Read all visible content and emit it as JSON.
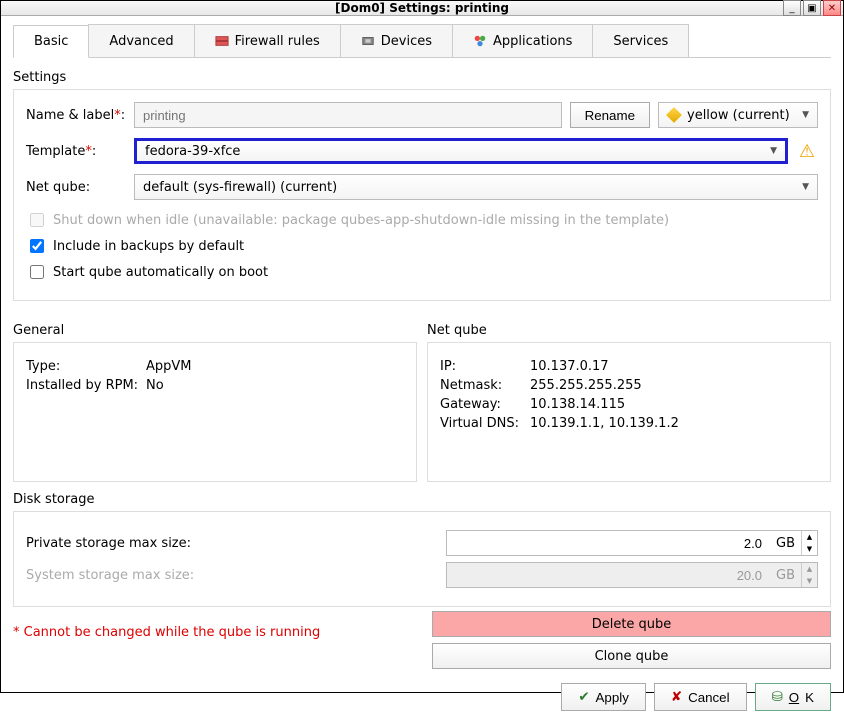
{
  "window": {
    "title": "[Dom0] Settings: printing"
  },
  "tabs": {
    "basic": "Basic",
    "advanced": "Advanced",
    "firewall": "Firewall rules",
    "devices": "Devices",
    "applications": "Applications",
    "services": "Services"
  },
  "settings": {
    "heading": "Settings",
    "name_label": "Name & label",
    "name_value": "printing",
    "rename_btn": "Rename",
    "color_label": "yellow (current)",
    "template_label": "Template",
    "template_value": "fedora-39-xfce",
    "netqube_label": "Net qube:",
    "netqube_value": "default (sys-firewall) (current)",
    "shutdown_idle": "Shut down when idle (unavailable: package qubes-app-shutdown-idle missing in the template)",
    "include_backups": "Include in backups by default",
    "autostart": "Start qube automatically on boot"
  },
  "general": {
    "heading": "General",
    "type_k": "Type:",
    "type_v": "AppVM",
    "rpm_k": "Installed by RPM:",
    "rpm_v": "No"
  },
  "netinfo": {
    "heading": "Net qube",
    "ip_k": "IP:",
    "ip_v": "10.137.0.17",
    "mask_k": "Netmask:",
    "mask_v": "255.255.255.255",
    "gw_k": "Gateway:",
    "gw_v": "10.138.14.115",
    "dns_k": "Virtual DNS:",
    "dns_v": "10.139.1.1, 10.139.1.2"
  },
  "disk": {
    "heading": "Disk storage",
    "priv_label": "Private storage max size:",
    "priv_value": "2.0",
    "priv_unit": "GB",
    "sys_label": "System storage max size:",
    "sys_value": "20.0",
    "sys_unit": "GB"
  },
  "footer": {
    "warn": "Cannot be changed while the qube is running",
    "delete": "Delete qube",
    "clone": "Clone qube",
    "apply": "Apply",
    "cancel": "Cancel",
    "ok": "OK"
  }
}
